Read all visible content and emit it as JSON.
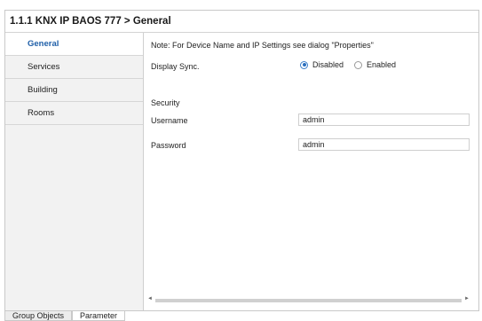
{
  "header": {
    "title": "1.1.1 KNX IP BAOS 777 > General"
  },
  "sidebar": {
    "items": [
      {
        "label": "General",
        "active": true
      },
      {
        "label": "Services",
        "active": false
      },
      {
        "label": "Building",
        "active": false
      },
      {
        "label": "Rooms",
        "active": false
      }
    ]
  },
  "main": {
    "note": "Note: For Device Name and IP Settings see dialog \"Properties\"",
    "display_sync": {
      "label": "Display Sync.",
      "options": [
        "Disabled",
        "Enabled"
      ],
      "selected": "Disabled"
    },
    "security_heading": "Security",
    "username": {
      "label": "Username",
      "value": "admin"
    },
    "password": {
      "label": "Password",
      "value": "admin"
    }
  },
  "tabs": [
    {
      "label": "Group Objects",
      "active": false
    },
    {
      "label": "Parameter",
      "active": true
    }
  ],
  "colors": {
    "accent": "#1f5fa8",
    "sidebar_bg": "#f2f2f2",
    "border": "#c9c9c9"
  }
}
